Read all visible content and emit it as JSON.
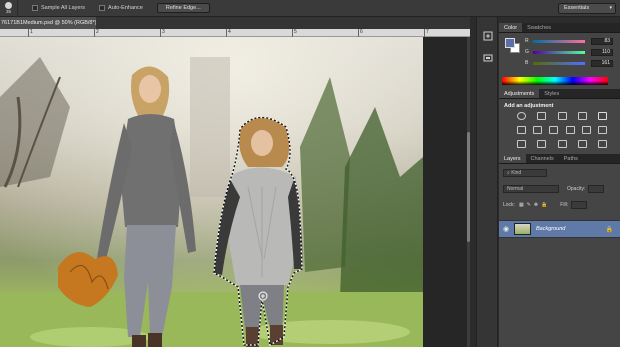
{
  "options_bar": {
    "tool_preset_number": "35",
    "sample_all_layers_label": "Sample All Layers",
    "auto_enhance_label": "Auto-Enhance",
    "refine_edge_label": "Refine Edge...",
    "workspace_label": "Essentials"
  },
  "document": {
    "tab_title": "76171B1Medium.psd @ 50% (RGB/8*)"
  },
  "ruler": {
    "ticks": [
      "1",
      "2",
      "3",
      "4",
      "5",
      "6",
      "7"
    ]
  },
  "color_panel": {
    "tabs": [
      "Color",
      "Swatches"
    ],
    "channels": [
      {
        "label": "R",
        "value": "83"
      },
      {
        "label": "G",
        "value": "110"
      },
      {
        "label": "B",
        "value": "161"
      }
    ],
    "foreground_color": "#5370a1",
    "background_color": "#ffffff"
  },
  "adjustments_panel": {
    "tabs": [
      "Adjustments",
      "Styles"
    ],
    "heading": "Add an adjustment"
  },
  "layers_panel": {
    "tabs": [
      "Layers",
      "Channels",
      "Paths"
    ],
    "filter_label": "Kind",
    "blend_mode": "Normal",
    "opacity_label": "Opacity:",
    "lock_label": "Lock:",
    "fill_label": "Fill:",
    "layers": [
      {
        "name": "Background",
        "visible": true,
        "locked": true,
        "selected": true
      }
    ]
  },
  "colors": {
    "selection_highlight": "#5f7aa8",
    "panel_bg": "#454545",
    "app_bg": "#2b2b2b"
  }
}
